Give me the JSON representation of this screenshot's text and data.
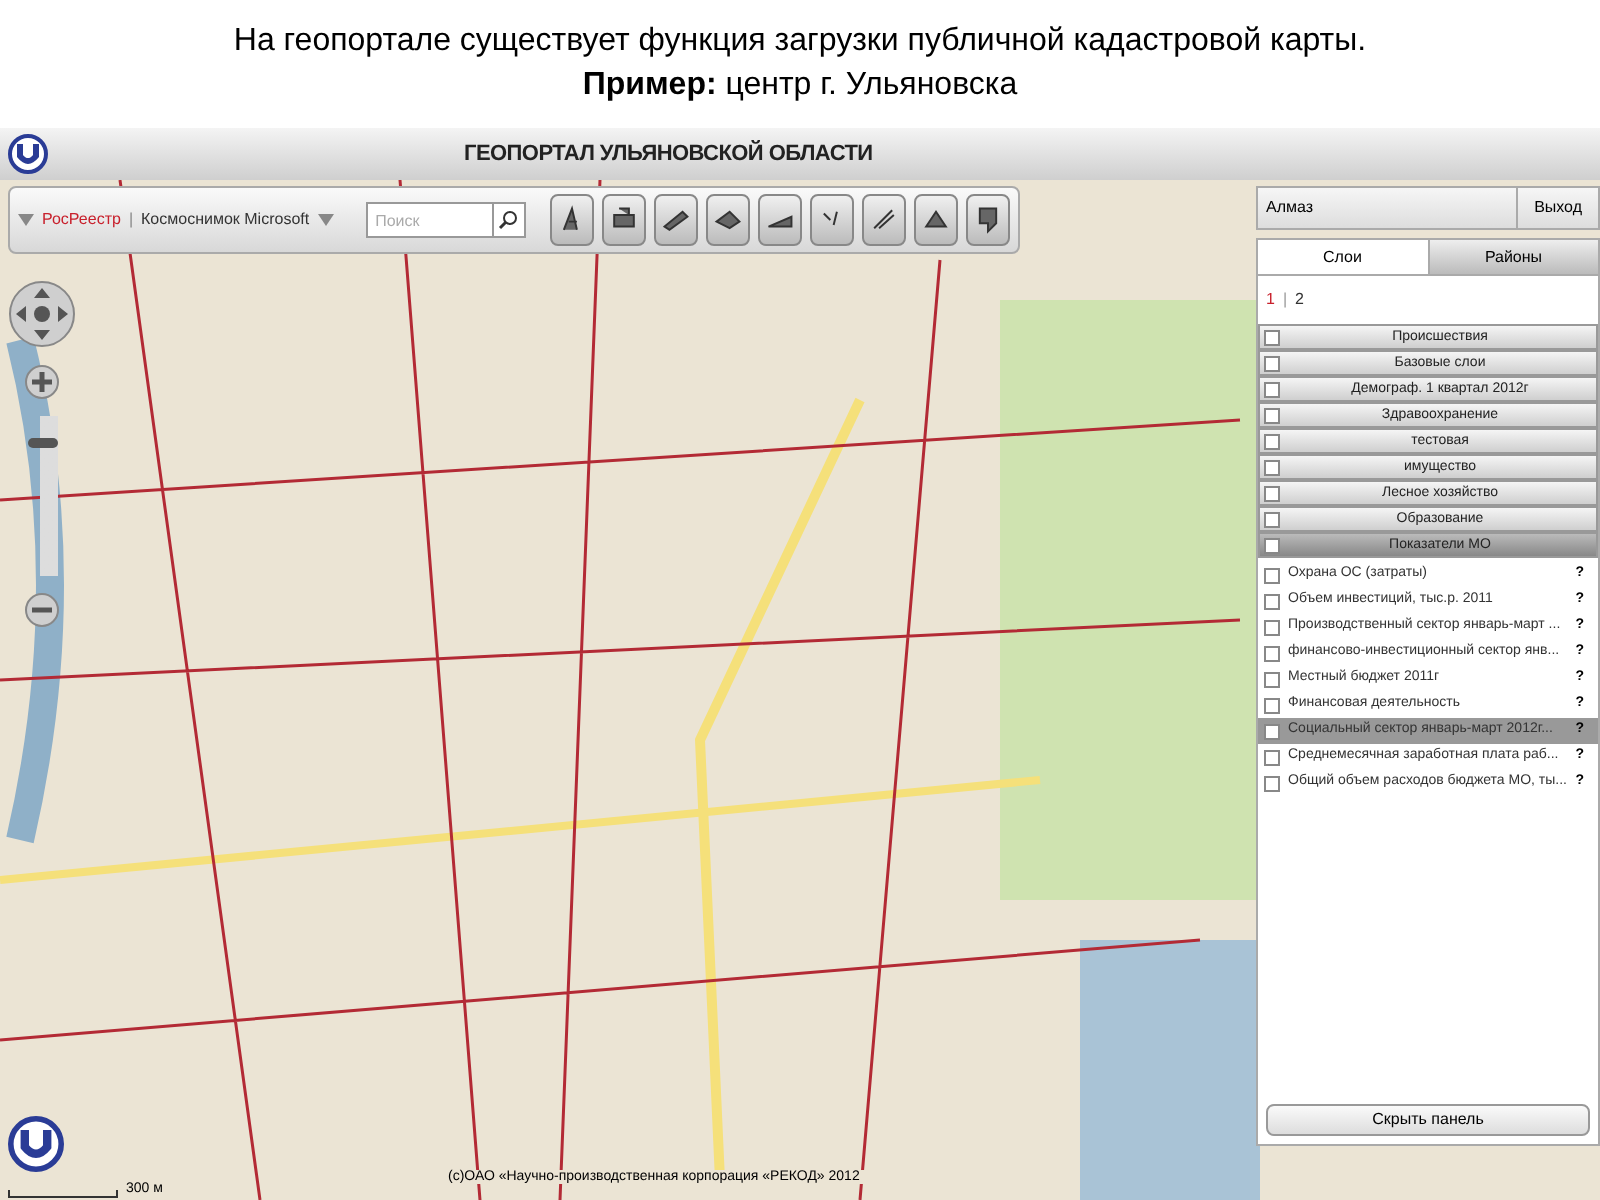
{
  "slide": {
    "line_1": "На геопортале существует функция загрузки публичной кадастровой карты.",
    "line_2": "**Пример:** центр г. Ульяновска"
  },
  "window": {
    "title": "ГЕОПОРТАЛ УЛЬЯНОВСКОЙ ОБЛАСТИ"
  },
  "toolbar": {
    "basemaps": [
      {
        "label": "РосРеестр",
        "selected": true
      },
      {
        "label": "Космоснимок Microsoft",
        "selected": false
      }
    ],
    "separator": "|",
    "search": {
      "placeholder": "Поиск"
    }
  },
  "zoom": {
    "level": 0.85
  },
  "scale": "300 м",
  "panel": {
    "user": "Алмаз",
    "logout": "Выход",
    "tabs": [
      {
        "label": "Слои",
        "selected": true
      },
      {
        "label": "Районы",
        "selected": false
      }
    ],
    "pages": [
      {
        "label": "1",
        "selected": true
      },
      {
        "label": "2",
        "selected": false
      }
    ],
    "page_separator": "|",
    "groups": [
      {
        "label": "Происшествия",
        "checked": false,
        "expanded": false
      },
      {
        "label": "Базовые слои",
        "checked": false,
        "expanded": false
      },
      {
        "label": "Демограф. 1 квартал 2012г",
        "checked": false,
        "expanded": false
      },
      {
        "label": "Здравоохранение",
        "checked": false,
        "expanded": false
      },
      {
        "label": "тестовая",
        "checked": false,
        "expanded": false
      },
      {
        "label": "имущество",
        "checked": false,
        "expanded": false
      },
      {
        "label": "Лесное хозяйство",
        "checked": false,
        "expanded": false
      },
      {
        "label": "Образование",
        "checked": false,
        "expanded": false
      },
      {
        "label": "Показатели МО",
        "checked": false,
        "expanded": true,
        "children": [
          {
            "label": "Охрана ОС (затраты)",
            "checked": false,
            "selected": false,
            "help": "?"
          },
          {
            "label": "Объем инвестиций, тыс.р. 2011",
            "checked": false,
            "selected": false,
            "help": "?"
          },
          {
            "label": "Производственный сектор январь-март ...",
            "checked": false,
            "selected": false,
            "help": "?"
          },
          {
            "label": "финансово-инвестиционный сектор янв...",
            "checked": false,
            "selected": false,
            "help": "?"
          },
          {
            "label": "Местный бюджет 2011г",
            "checked": false,
            "selected": false,
            "help": "?"
          },
          {
            "label": "Финансовая деятельность",
            "checked": false,
            "selected": false,
            "help": "?"
          },
          {
            "label": "Социальный сектор январь-март 2012г...",
            "checked": false,
            "selected": true,
            "help": "?"
          },
          {
            "label": "Среднемесячная заработная плата раб...",
            "checked": false,
            "selected": false,
            "help": "?"
          },
          {
            "label": "Общий объем расходов бюджета МО, ты...",
            "checked": false,
            "selected": false,
            "help": "?"
          }
        ]
      }
    ],
    "hide_button": "Скрыть панель"
  },
  "copyright": "(c)ОАО «Научно-производственная корпорация «РЕКОД» 2012"
}
